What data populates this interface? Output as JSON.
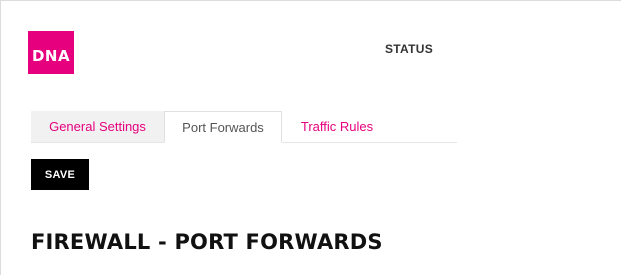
{
  "header": {
    "logo_text": "DNA",
    "nav": {
      "status_label": "STATUS"
    }
  },
  "tabs": [
    {
      "label": "General Settings",
      "active": false
    },
    {
      "label": "Port Forwards",
      "active": true
    },
    {
      "label": "Traffic Rules",
      "active": false
    }
  ],
  "toolbar": {
    "save_label": "SAVE"
  },
  "page": {
    "title": "FIREWALL - PORT FORWARDS"
  },
  "colors": {
    "brand": "#e6007e",
    "button_bg": "#000000",
    "tab_inactive_bg": "#f1f1f1"
  }
}
